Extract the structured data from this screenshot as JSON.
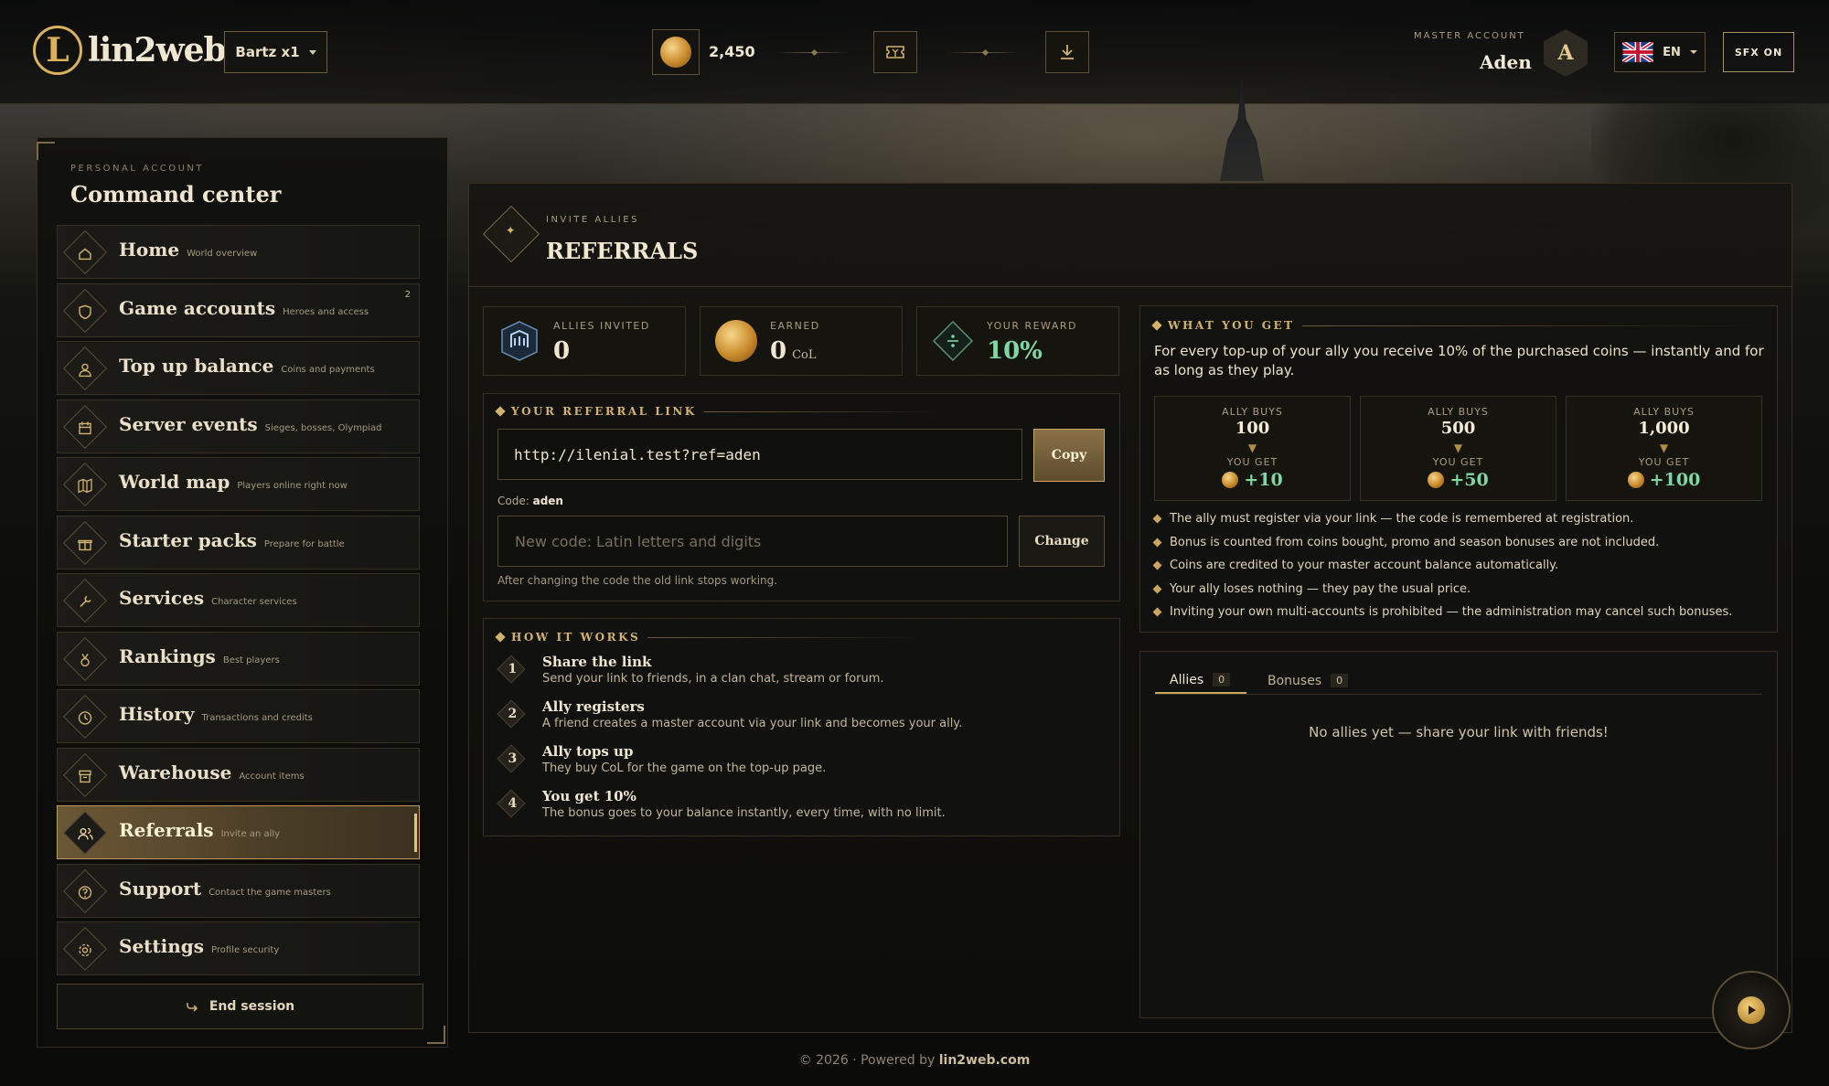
{
  "brand": {
    "logo_text": "lin2web"
  },
  "topbar": {
    "server": "Bartz x1",
    "coins": "2,450",
    "master_label": "MASTER ACCOUNT",
    "master_name": "Aden",
    "avatar_letter": "A",
    "language": "EN",
    "sfx": "SFX ON"
  },
  "sidebar": {
    "kicker": "PERSONAL ACCOUNT",
    "title": "Command center",
    "items": [
      {
        "label": "Home",
        "sub": "World overview",
        "icon": "home-icon"
      },
      {
        "label": "Game accounts",
        "sub": "Heroes and access",
        "icon": "shield-icon",
        "badge": "2"
      },
      {
        "label": "Top up balance",
        "sub": "Coins and payments",
        "icon": "coin-bag-icon"
      },
      {
        "label": "Server events",
        "sub": "Sieges, bosses, Olympiad",
        "icon": "calendar-icon"
      },
      {
        "label": "World map",
        "sub": "Players online right now",
        "icon": "map-icon"
      },
      {
        "label": "Starter packs",
        "sub": "Prepare for battle",
        "icon": "gift-icon"
      },
      {
        "label": "Services",
        "sub": "Character services",
        "icon": "wrench-icon"
      },
      {
        "label": "Rankings",
        "sub": "Best players",
        "icon": "medal-icon"
      },
      {
        "label": "History",
        "sub": "Transactions and credits",
        "icon": "clock-icon"
      },
      {
        "label": "Warehouse",
        "sub": "Account items",
        "icon": "box-icon"
      },
      {
        "label": "Referrals",
        "sub": "Invite an ally",
        "icon": "users-icon",
        "active": true
      },
      {
        "label": "Support",
        "sub": "Contact the game masters",
        "icon": "help-icon"
      },
      {
        "label": "Settings",
        "sub": "Profile security",
        "icon": "gear-icon"
      }
    ],
    "end_session": "End session"
  },
  "header": {
    "kicker": "INVITE ALLIES",
    "title": "REFERRALS"
  },
  "stats": [
    {
      "label": "ALLIES INVITED",
      "value": "0"
    },
    {
      "label": "EARNED",
      "value": "0",
      "unit": "CoL"
    },
    {
      "label": "YOUR REWARD",
      "value": "10%"
    }
  ],
  "referral_link": {
    "heading": "YOUR REFERRAL LINK",
    "url": "http://ilenial.test?ref=aden",
    "copy_label": "Copy",
    "code_label": "Code:",
    "code": "aden",
    "new_code_placeholder": "New code: Latin letters and digits",
    "change_label": "Change",
    "note": "After changing the code the old link stops working."
  },
  "how_it_works": {
    "heading": "HOW IT WORKS",
    "steps": [
      {
        "n": "1",
        "title": "Share the link",
        "desc": "Send your link to friends, in a clan chat, stream or forum."
      },
      {
        "n": "2",
        "title": "Ally registers",
        "desc": "A friend creates a master account via your link and becomes your ally."
      },
      {
        "n": "3",
        "title": "Ally tops up",
        "desc": "They buy CoL for the game on the top-up page."
      },
      {
        "n": "4",
        "title": "You get 10%",
        "desc": "The bonus goes to your balance instantly, every time, with no limit."
      }
    ]
  },
  "what_you_get": {
    "heading": "WHAT YOU GET",
    "intro": "For every top-up of your ally you receive 10% of the purchased coins — instantly and for as long as they play.",
    "buys_label": "ALLY BUYS",
    "get_label": "YOU GET",
    "tiers": [
      {
        "buys": "100",
        "gets": "+10"
      },
      {
        "buys": "500",
        "gets": "+50"
      },
      {
        "buys": "1,000",
        "gets": "+100"
      }
    ],
    "rules": [
      "The ally must register via your link — the code is remembered at registration.",
      "Bonus is counted from coins bought, promo and season bonuses are not included.",
      "Coins are credited to your master account balance automatically.",
      "Your ally loses nothing — they pay the usual price.",
      "Inviting your own multi-accounts is prohibited — the administration may cancel such bonuses."
    ]
  },
  "tabs": [
    {
      "label": "Allies",
      "count": "0"
    },
    {
      "label": "Bonuses",
      "count": "0"
    }
  ],
  "empty_message": "No allies yet — share your link with friends!",
  "footer": {
    "prefix": "© 2026 · Powered by",
    "brand": "lin2web.com"
  },
  "colors": {
    "accent": "#d2b26c",
    "positive": "#7fd7a4",
    "background": "#0c0c0a"
  }
}
